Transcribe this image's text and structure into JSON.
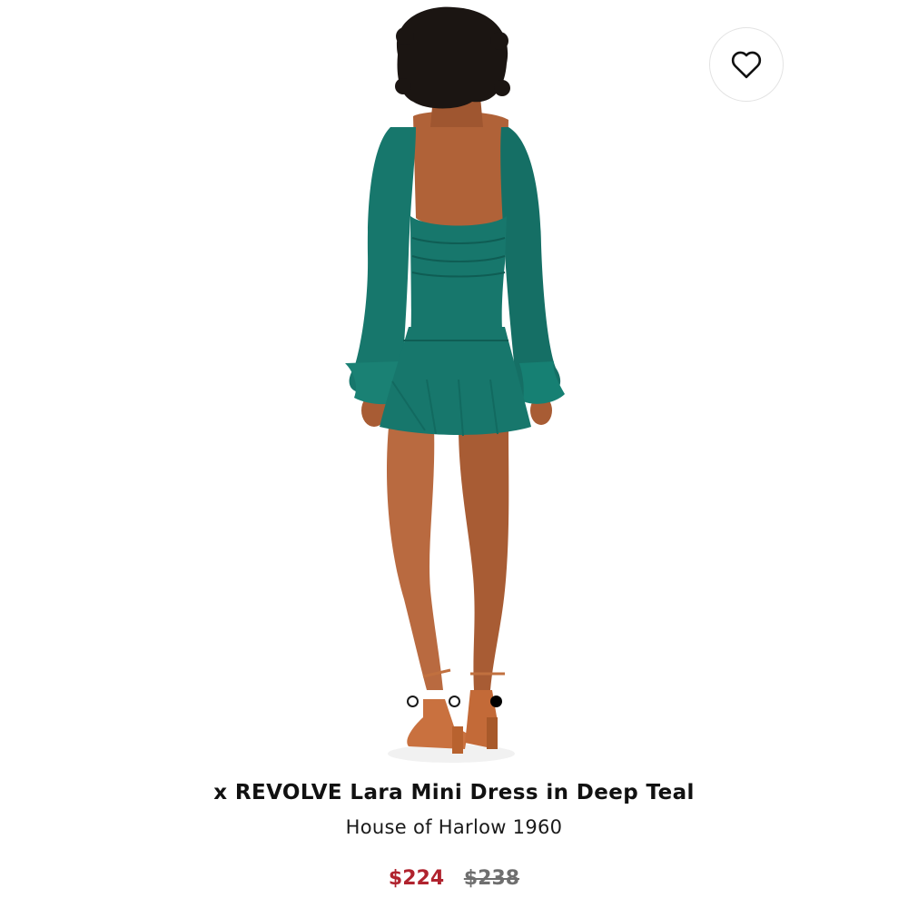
{
  "product": {
    "title": "x REVOLVE Lara Mini Dress in Deep Teal",
    "brand": "House of Harlow 1960",
    "sale_price": "$224",
    "original_price": "$238"
  },
  "gallery": {
    "image_count": 3,
    "active_index": 3
  },
  "wishlist": {
    "icon": "heart-icon"
  },
  "colors": {
    "dress": "#17776c",
    "sale_price": "#b0232e",
    "original_price": "#6f6f6f"
  }
}
